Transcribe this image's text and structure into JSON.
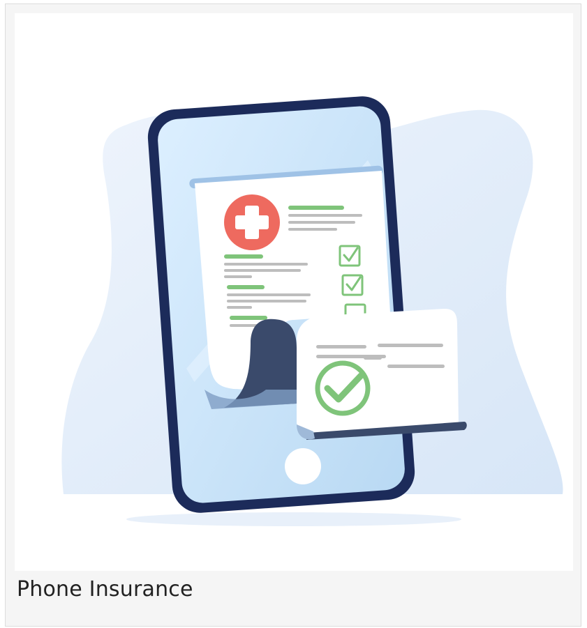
{
  "card": {
    "caption": "Phone Insurance"
  },
  "illustration": {
    "subject": "phone-with-medical-document",
    "colors": {
      "phone_frame": "#1c2b5a",
      "screen": "#cfe6f8",
      "blob": "#e4eefa",
      "paper": "#ffffff",
      "green": "#7fc47a",
      "red_cross_bg": "#ee6a5f",
      "gray_line": "#bdbdbd",
      "shadow_dark": "#3a4a6b"
    }
  }
}
